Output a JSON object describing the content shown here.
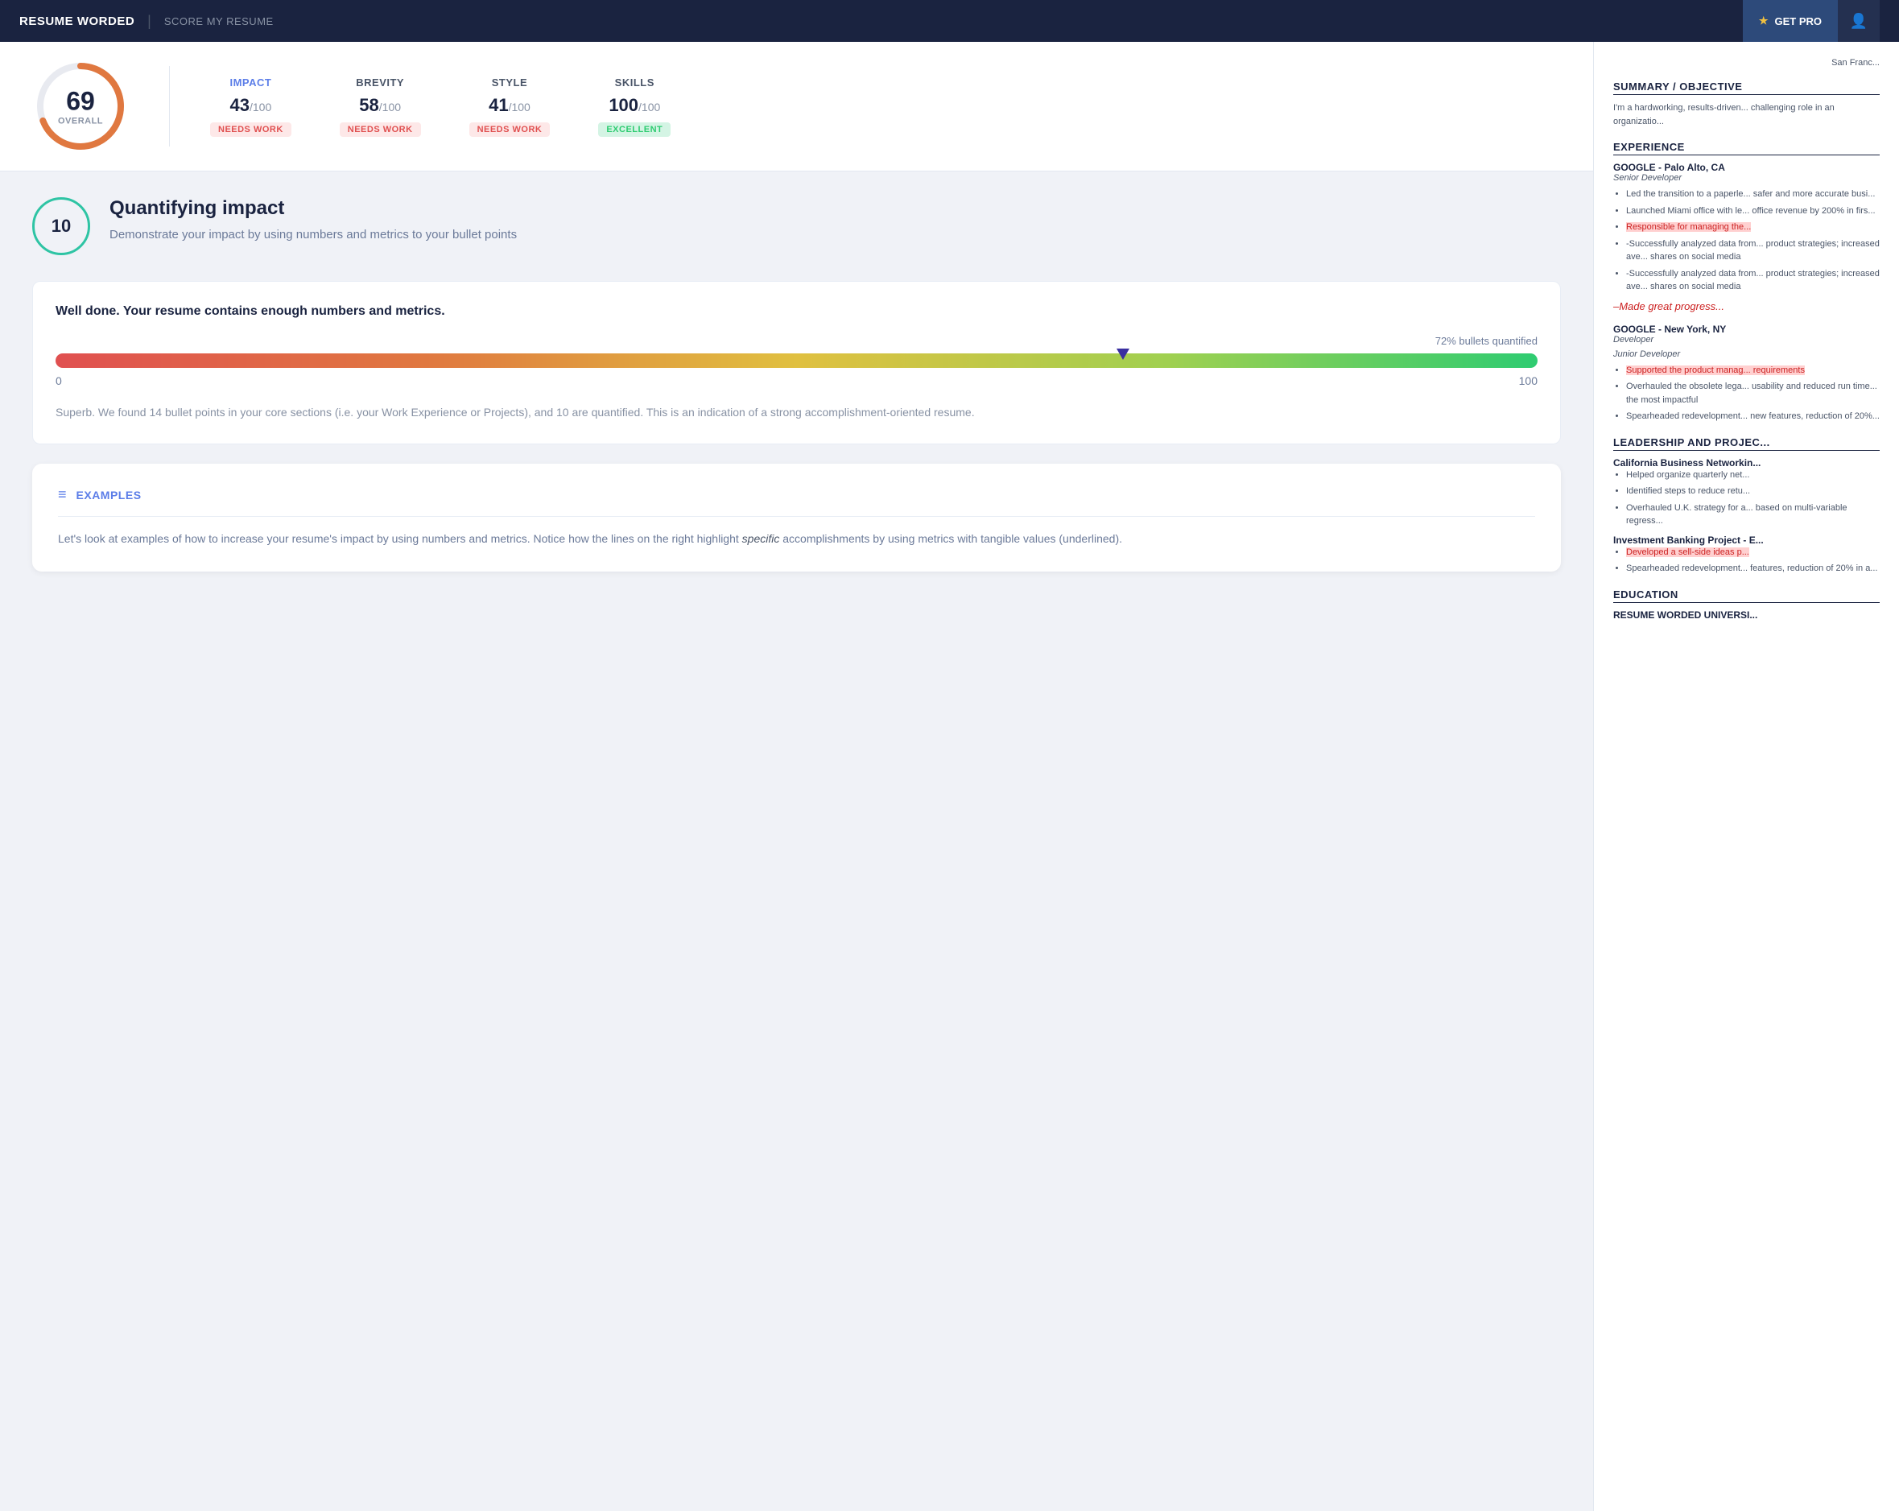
{
  "header": {
    "logo": "RESUME WORDED",
    "divider": "|",
    "subtitle": "SCORE MY RESUME",
    "get_pro_label": "GET PRO",
    "star_icon": "★",
    "user_icon": "👤"
  },
  "score_bar": {
    "overall": {
      "score": 69,
      "label": "OVERALL"
    },
    "categories": [
      {
        "name": "IMPACT",
        "score": 43,
        "denom": 100,
        "badge": "NEEDS WORK",
        "badge_type": "needs-work",
        "highlight": true
      },
      {
        "name": "BREVITY",
        "score": 58,
        "denom": 100,
        "badge": "NEEDS WORK",
        "badge_type": "needs-work",
        "highlight": false
      },
      {
        "name": "STYLE",
        "score": 41,
        "denom": 100,
        "badge": "NEEDS WORK",
        "badge_type": "needs-work",
        "highlight": false
      },
      {
        "name": "SKILLS",
        "score": 100,
        "denom": 100,
        "badge": "EXCELLENT",
        "badge_type": "excellent",
        "highlight": false
      }
    ]
  },
  "quantifying_impact": {
    "badge_number": 10,
    "title": "Quantifying impact",
    "description": "Demonstrate your impact by using numbers and metrics to your bullet points"
  },
  "progress": {
    "well_done_text": "Well done. Your resume contains enough numbers and metrics.",
    "percent_label": "72% bullets quantified",
    "percent_value": 72,
    "range_start": "0",
    "range_end": "100",
    "description": "Superb. We found 14 bullet points in your core sections (i.e. your Work Experience or Projects), and 10 are quantified. This is an indication of a strong accomplishment-oriented resume."
  },
  "examples": {
    "icon": "≡",
    "title": "EXAMPLES",
    "body_text": "Let's look at examples of how to increase your resume's impact by using numbers and metrics. Notice how the lines on the right highlight ",
    "italic_text": "specific",
    "body_text2": " accomplishments by using metrics with tangible values (underlined)."
  },
  "resume_preview": {
    "location": "San Franc...",
    "summary_title": "SUMMARY / OBJECTIVE",
    "summary_text": "I'm a hardworking, results-driven... challenging role in an organizatio...",
    "experience_title": "EXPERIENCE",
    "jobs": [
      {
        "company": "GOOGLE - Palo Alto, CA",
        "role": "Senior Developer",
        "bullets": [
          {
            "text": "Led the transition to a paperle... safer and more accurate busi...",
            "highlight": "none"
          },
          {
            "text": "Launched Miami office with le... office revenue by 200% in firs...",
            "highlight": "none"
          },
          {
            "text": "Responsible for managing the...",
            "highlight": "red"
          },
          {
            "text": "-Successfully analyzed data from... product strategies; increased ave... shares on social media",
            "highlight": "none"
          },
          {
            "text": "-Successfully analyzed data from... product strategies; increased ave... shares on social media",
            "highlight": "none"
          },
          {
            "text": "–Made great progress...",
            "highlight": "deleted",
            "strikethrough": true
          }
        ]
      },
      {
        "company": "GOOGLE - New York, NY",
        "role": "Developer",
        "role2": "Junior Developer",
        "bullets": [
          {
            "text": "Supported the product manag... requirements",
            "highlight": "red"
          },
          {
            "text": "Overhauled the obsolete lega... usability and reduced run time... the most impactful",
            "highlight": "none"
          },
          {
            "text": "Spearheaded redevelopment... new features, reduction of 20%...",
            "highlight": "none"
          }
        ]
      }
    ],
    "leadership_title": "LEADERSHIP AND PROJEC...",
    "leadership_items": [
      {
        "company": "California Business Networkin...",
        "bullets": [
          {
            "text": "Helped organize quarterly net...",
            "highlight": "none"
          },
          {
            "text": "Identified steps to reduce retu...",
            "highlight": "none"
          },
          {
            "text": "Overhauled U.K. strategy for a... based on multi-variable regress...",
            "highlight": "none"
          }
        ]
      },
      {
        "company": "Investment Banking Project - E...",
        "bullets": [
          {
            "text": "Developed a sell-side ideas p...",
            "highlight": "red"
          },
          {
            "text": "Spearheaded redevelopment... features, reduction of 20% in a...",
            "highlight": "none"
          }
        ]
      }
    ],
    "education_title": "EDUCATION",
    "education_items": [
      {
        "company": "RESUME WORDED UNIVERSI..."
      }
    ]
  }
}
